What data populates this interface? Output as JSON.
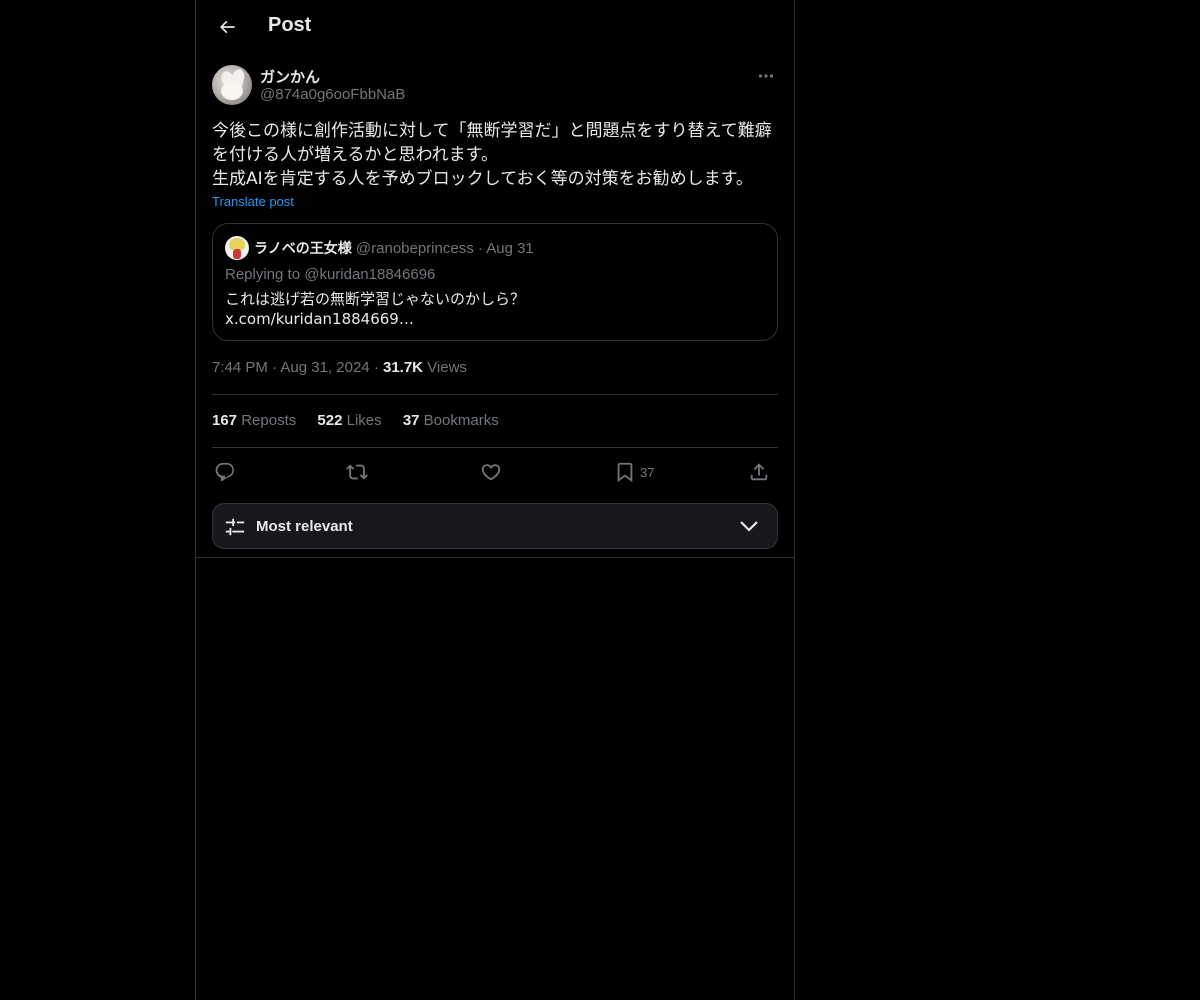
{
  "header": {
    "title": "Post",
    "back_icon": "arrow-left-icon"
  },
  "author": {
    "display_name": "ガンかん",
    "handle": "@874a0g6ooFbbNaB"
  },
  "post": {
    "text": "今後この様に創作活動に対して「無断学習だ」と問題点をすり替えて難癖\nを付ける人が増えるかと思われます。\n生成AIを肯定する人を予めブロックしておく等の対策をお勧めします。",
    "translate_label": "Translate post"
  },
  "quote": {
    "name": "ラノベの王女様",
    "handle": "@ranobeprincess",
    "separator": "·",
    "date": "Aug 31",
    "replying": "Replying to @kuridan18846696",
    "text": "これは逃げ若の無断学習じゃないのかしら？\nx.com/kuridan1884669…"
  },
  "meta": {
    "time": "7:44 PM",
    "sep1": "·",
    "date": "Aug 31, 2024",
    "sep2": "·",
    "views_count": "31.7K",
    "views_label": "Views"
  },
  "stats": {
    "reposts_count": "167",
    "reposts_label": "Reposts",
    "likes_count": "522",
    "likes_label": "Likes",
    "bookmarks_count": "37",
    "bookmarks_label": "Bookmarks"
  },
  "actions": {
    "bookmark_count": "37"
  },
  "sort": {
    "label": "Most relevant"
  },
  "colors": {
    "accent": "#1d9bf0",
    "text": "#e7e9ea",
    "muted": "#71767b",
    "border": "#2f3336",
    "background": "#000000"
  }
}
